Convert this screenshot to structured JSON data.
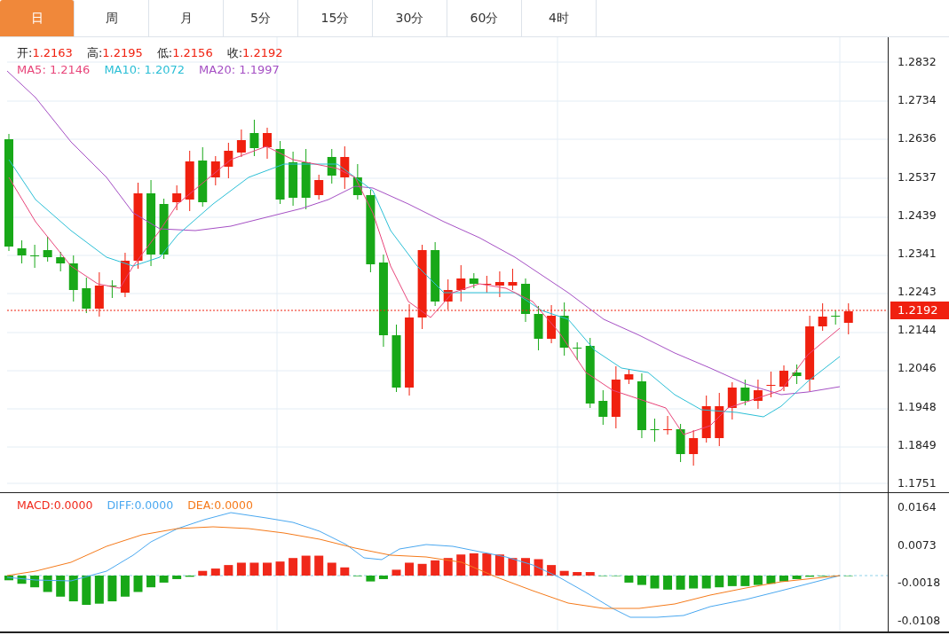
{
  "tabs": [
    {
      "label": "日",
      "selected": true
    },
    {
      "label": "周",
      "selected": false
    },
    {
      "label": "月",
      "selected": false
    },
    {
      "label": "5分",
      "selected": false
    },
    {
      "label": "15分",
      "selected": false
    },
    {
      "label": "30分",
      "selected": false
    },
    {
      "label": "60分",
      "selected": false
    },
    {
      "label": "4时",
      "selected": false
    }
  ],
  "ohlc": [
    {
      "label": "开:",
      "value": "1.2163"
    },
    {
      "label": "高:",
      "value": "1.2195"
    },
    {
      "label": "低:",
      "value": "1.2156"
    },
    {
      "label": "收:",
      "value": "1.2192"
    }
  ],
  "ma": [
    {
      "label": "MA5:",
      "value": "1.2146",
      "color": "#e8457a"
    },
    {
      "label": "MA10:",
      "value": "1.2072",
      "color": "#2bbfd6"
    },
    {
      "label": "MA20:",
      "value": "1.1997",
      "color": "#a54fc4"
    }
  ],
  "price_axis": {
    "ticks": [
      "1.2832",
      "1.2734",
      "1.2636",
      "1.2537",
      "1.2439",
      "1.2341",
      "1.2243",
      "1.2144",
      "1.2046",
      "1.1948",
      "1.1849",
      "1.1751"
    ],
    "current": "1.2192"
  },
  "macd": {
    "legend": [
      {
        "label": "MACD:",
        "value": "0.0000",
        "color": "#f0281a"
      },
      {
        "label": "DIFF:",
        "value": "0.0000",
        "color": "#4aa8f0"
      },
      {
        "label": "DEA:",
        "value": "0.0000",
        "color": "#f57a1a"
      }
    ],
    "ticks": [
      "0.0164",
      "0.0073",
      "-0.0018",
      "-0.0108"
    ]
  }
}
